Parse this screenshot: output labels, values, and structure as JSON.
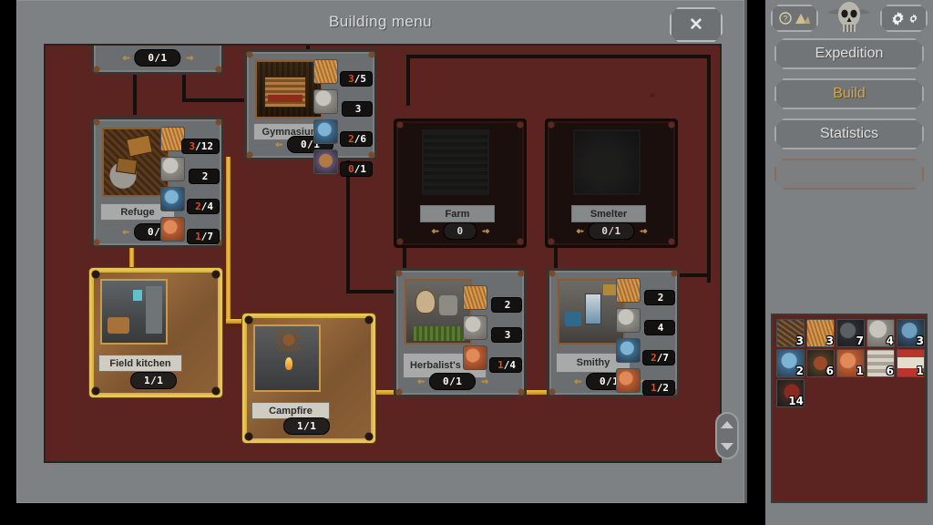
{
  "window": {
    "title": "Building menu",
    "close_label": "✕"
  },
  "scrollbar": {
    "up_icon": "chevron-up-icon",
    "down_icon": "chevron-down-icon"
  },
  "sidebar": {
    "help_icon": "question-mark-icon",
    "tent_icon": "tent-icon",
    "skull_icon": "skull-emblem-icon",
    "settings_icon": "gear-icon",
    "buttons": [
      {
        "label": "Expedition",
        "active": false
      },
      {
        "label": "Build",
        "active": true
      },
      {
        "label": "Statistics",
        "active": false
      }
    ]
  },
  "resources": [
    {
      "icon": "branches-icon",
      "count": "3"
    },
    {
      "icon": "straw-icon",
      "count": "3"
    },
    {
      "icon": "coal-icon",
      "count": "7"
    },
    {
      "icon": "stone-icon",
      "count": "4"
    },
    {
      "icon": "ore-icon",
      "count": "3"
    },
    {
      "icon": "scrap-metal-icon",
      "count": "2"
    },
    {
      "icon": "herbs-icon",
      "count": "6"
    },
    {
      "icon": "meat-icon",
      "count": "1"
    },
    {
      "icon": "cloth-icon",
      "count": "6"
    },
    {
      "icon": "bandage-icon",
      "count": "1"
    },
    {
      "icon": "leather-icon",
      "count": "14"
    }
  ],
  "buildings": [
    {
      "id": "top-partial",
      "name": "",
      "status": "0/1",
      "state": "available",
      "costs": []
    },
    {
      "id": "gymnasium",
      "name": "Gymnasium",
      "status": "0/1",
      "state": "available",
      "costs": [
        {
          "icon": "straw-icon",
          "have": "3",
          "sep": "/",
          "need": "5"
        },
        {
          "icon": "stone-icon",
          "have": "",
          "sep": "",
          "need": "3"
        },
        {
          "icon": "scrap-metal-icon",
          "have": "2",
          "sep": "/",
          "need": "6"
        },
        {
          "icon": "ore-icon",
          "have": "0",
          "sep": "/",
          "need": "1"
        }
      ]
    },
    {
      "id": "refuge",
      "name": "Refuge",
      "status": "0/1",
      "state": "available",
      "costs": [
        {
          "icon": "straw-icon",
          "have": "3",
          "sep": "/",
          "need": "12"
        },
        {
          "icon": "stone-icon",
          "have": "",
          "sep": "",
          "need": "2"
        },
        {
          "icon": "scrap-metal-icon",
          "have": "2",
          "sep": "/",
          "need": "4"
        },
        {
          "icon": "meat-icon",
          "have": "1",
          "sep": "/",
          "need": "7"
        }
      ]
    },
    {
      "id": "farm",
      "name": "Farm",
      "status": "0",
      "state": "locked",
      "costs": []
    },
    {
      "id": "smelter",
      "name": "Smelter",
      "status": "0/1",
      "state": "locked",
      "costs": []
    },
    {
      "id": "field-kitchen",
      "name": "Field kitchen",
      "status": "1/1",
      "state": "built",
      "costs": []
    },
    {
      "id": "campfire",
      "name": "Campfire",
      "status": "1/1",
      "state": "built",
      "costs": []
    },
    {
      "id": "herbalists-hut",
      "name": "Herbalist's hut",
      "status": "0/1",
      "state": "available",
      "costs": [
        {
          "icon": "straw-icon",
          "have": "",
          "sep": "",
          "need": "2"
        },
        {
          "icon": "stone-icon",
          "have": "",
          "sep": "",
          "need": "3"
        },
        {
          "icon": "meat-icon",
          "have": "1",
          "sep": "/",
          "need": "4"
        }
      ]
    },
    {
      "id": "smithy",
      "name": "Smithy",
      "status": "0/1",
      "state": "available",
      "costs": [
        {
          "icon": "straw-icon",
          "have": "",
          "sep": "",
          "need": "2"
        },
        {
          "icon": "stone-icon",
          "have": "",
          "sep": "",
          "need": "4"
        },
        {
          "icon": "scrap-metal-icon",
          "have": "2",
          "sep": "/",
          "need": "7"
        },
        {
          "icon": "meat-icon",
          "have": "1",
          "sep": "/",
          "need": "2"
        }
      ]
    }
  ],
  "colors": {
    "scene_bg": "#5c2420",
    "panel_gray": "#7e8183",
    "accent_gold": "#d4a44a",
    "cost_missing": "#e04a20",
    "link_unlocked": "#e8bf4a",
    "link_locked": "#14100f"
  }
}
